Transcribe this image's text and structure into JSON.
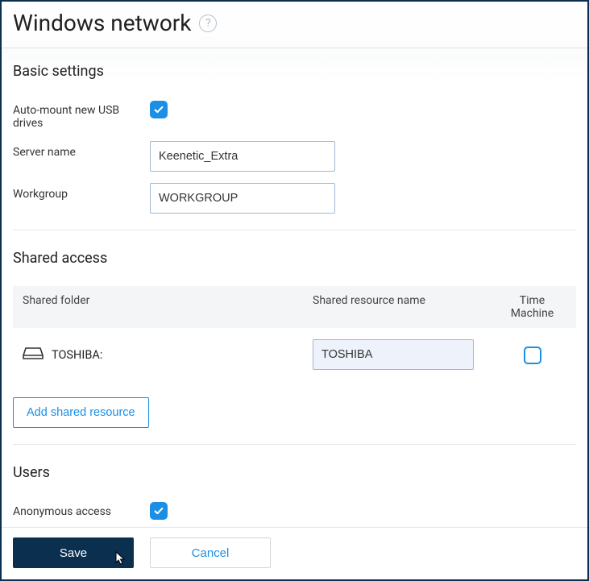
{
  "title": "Windows network",
  "sections": {
    "basic": {
      "title": "Basic settings",
      "automount_label": "Auto-mount new USB drives",
      "automount_checked": true,
      "server_label": "Server name",
      "server_value": "Keenetic_Extra",
      "workgroup_label": "Workgroup",
      "workgroup_value": "WORKGROUP"
    },
    "shared": {
      "title": "Shared access",
      "columns": {
        "folder": "Shared folder",
        "resource": "Shared resource name",
        "tm": "Time Machine"
      },
      "rows": [
        {
          "folder": "TOSHIBA:",
          "resource": "TOSHIBA",
          "tm_checked": false
        }
      ],
      "add_button": "Add shared resource"
    },
    "users": {
      "title": "Users",
      "anon_label": "Anonymous access",
      "anon_checked": true
    }
  },
  "footer": {
    "save": "Save",
    "cancel": "Cancel"
  }
}
